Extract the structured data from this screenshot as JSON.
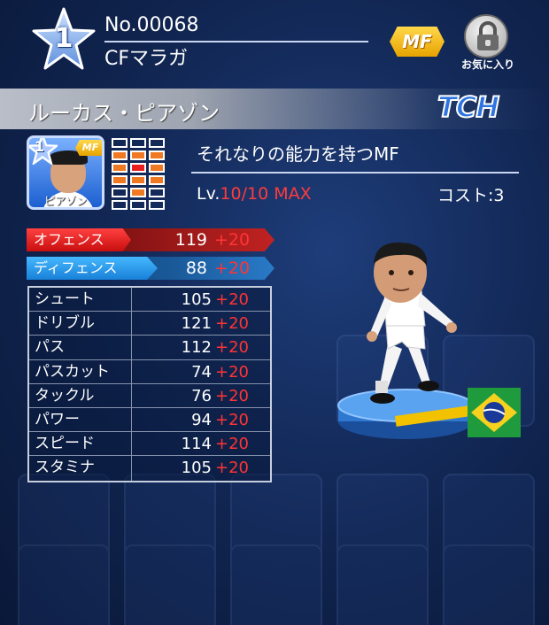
{
  "card": {
    "rarity": "1",
    "number": "No.00068",
    "card_name": "CFマラガ",
    "position": "MF",
    "favorite_label": "お気に入り"
  },
  "player": {
    "name": "ルーカス・ピアゾン",
    "type_badge": "TCH",
    "mini_card": {
      "rarity": "1",
      "position": "MF",
      "name": "ピアゾン"
    },
    "description": "それなりの能力を持つMF",
    "level_prefix": "Lv.",
    "level_value": "10/10 MAX",
    "cost": "コスト:3"
  },
  "summary": [
    {
      "key": "offense",
      "label": "オフェンス",
      "value": "119",
      "bonus": "+20"
    },
    {
      "key": "defense",
      "label": "ディフェンス",
      "value": "88",
      "bonus": "+20"
    }
  ],
  "stats": [
    {
      "label": "シュート",
      "value": "105",
      "bonus": "+20"
    },
    {
      "label": "ドリブル",
      "value": "121",
      "bonus": "+20"
    },
    {
      "label": "パス",
      "value": "112",
      "bonus": "+20"
    },
    {
      "label": "パスカット",
      "value": "74",
      "bonus": "+20"
    },
    {
      "label": "タックル",
      "value": "76",
      "bonus": "+20"
    },
    {
      "label": "パワー",
      "value": "94",
      "bonus": "+20"
    },
    {
      "label": "スピード",
      "value": "114",
      "bonus": "+20"
    },
    {
      "label": "スタミナ",
      "value": "105",
      "bonus": "+20"
    }
  ],
  "icons": {
    "rarity": "star-icon",
    "favorite": "lock-icon",
    "nationality": "brazil-flag-icon"
  },
  "colors": {
    "position_badge": "#f0b400",
    "bonus": "#ff3434",
    "offense": "#c80e0e",
    "defense": "#1880d8",
    "tch": "#2d74e0"
  }
}
